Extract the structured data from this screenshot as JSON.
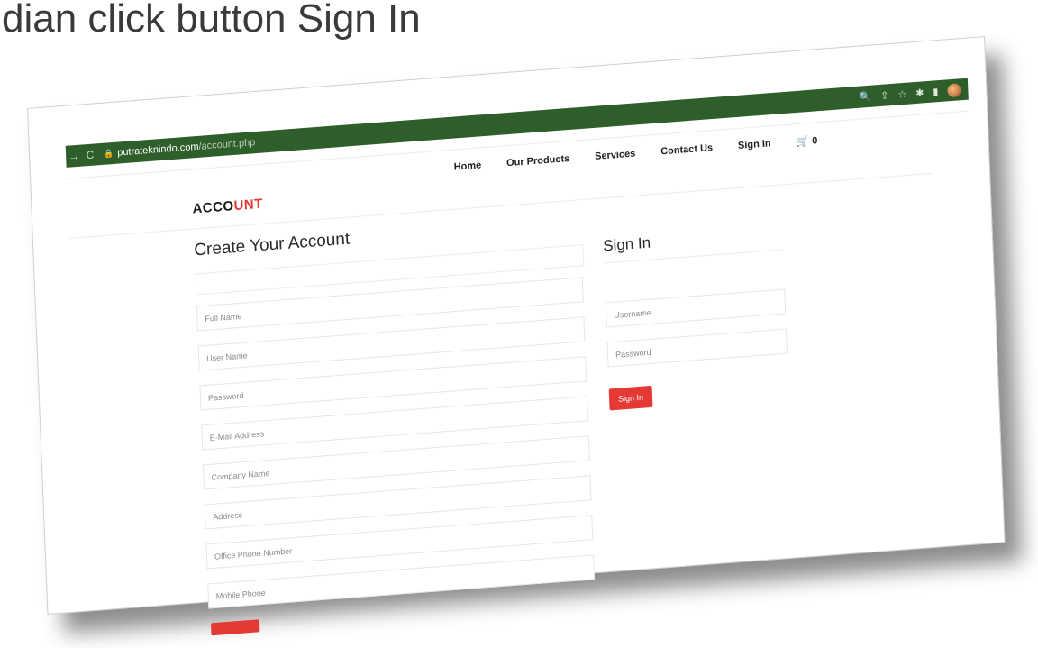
{
  "caption": "dian click button Sign In",
  "browser": {
    "back_icon": "arrow-right-icon",
    "reload_icon": "reload-icon",
    "url_host": "putrateknindo.com",
    "url_path": "/account.php"
  },
  "nav": {
    "items": [
      "Home",
      "Our Products",
      "Services",
      "Contact Us",
      "Sign In"
    ],
    "cart_count": "0"
  },
  "logo": {
    "part1": "ACCO",
    "part2": "UNT",
    "accent_color": "#e53935"
  },
  "create_account": {
    "title": "Create Your Account",
    "placeholders": {
      "full_name": "Full Name",
      "user_name": "User Name",
      "password": "Password",
      "email": "E-Mail Address",
      "company": "Company Name",
      "address": "Address",
      "office_phone": "Office Phone Number",
      "mobile_phone": "Mobile Phone"
    }
  },
  "sign_in": {
    "title": "Sign In",
    "placeholders": {
      "username": "Username",
      "password": "Password"
    },
    "button_label": "Sign In"
  }
}
